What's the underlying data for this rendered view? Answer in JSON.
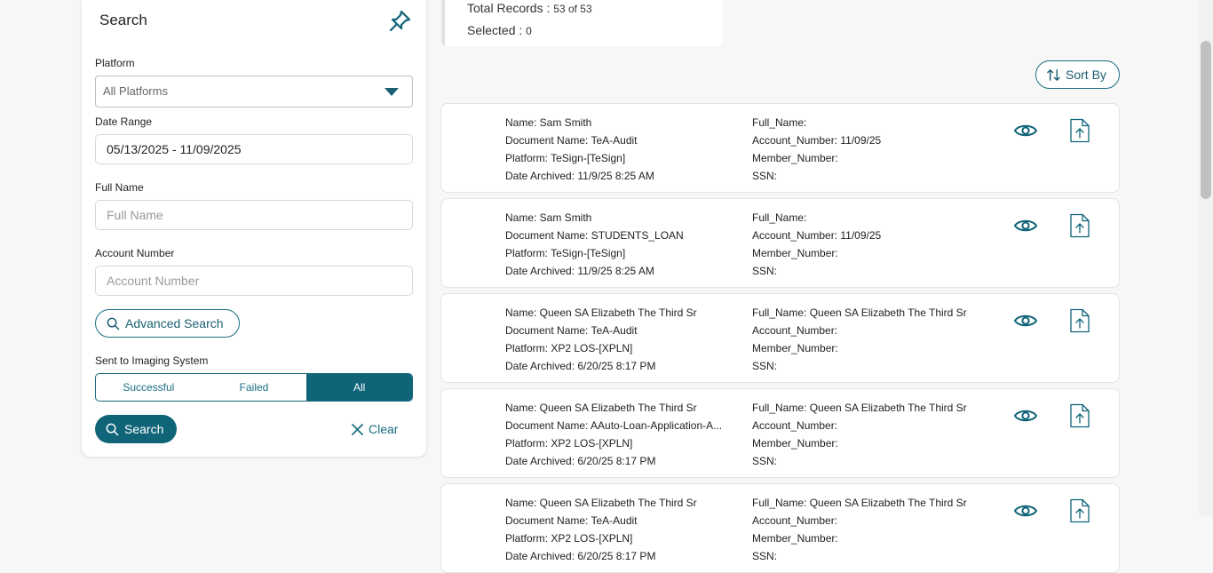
{
  "search_panel": {
    "title": "Search",
    "platform_label": "Platform",
    "platform_value": "All Platforms",
    "date_range_label": "Date Range",
    "date_range_value": "05/13/2025 - 11/09/2025",
    "full_name_label": "Full Name",
    "full_name_placeholder": "Full Name",
    "account_number_label": "Account Number",
    "account_number_placeholder": "Account Number",
    "advanced_search_label": "Advanced Search",
    "sent_label": "Sent to Imaging System",
    "segments": [
      "Successful",
      "Failed",
      "All"
    ],
    "active_segment": "All",
    "search_label": "Search",
    "clear_label": "Clear"
  },
  "totals": {
    "total_label": "Total Records :",
    "total_value": "53 of 53",
    "selected_label": "Selected :",
    "selected_value": "0"
  },
  "sort_label": "Sort By",
  "records": [
    {
      "left": [
        "Name: Sam Smith",
        "Document Name: TeA-Audit",
        "Platform: TeSign-[TeSign]",
        "Date Archived: 11/9/25 8:25 AM"
      ],
      "right": [
        "Full_Name:",
        "Account_Number: 11/09/25",
        "Member_Number:",
        "SSN:"
      ]
    },
    {
      "left": [
        "Name: Sam Smith",
        "Document Name: STUDENTS_LOAN",
        "Platform: TeSign-[TeSign]",
        "Date Archived: 11/9/25 8:25 AM"
      ],
      "right": [
        "Full_Name:",
        "Account_Number: 11/09/25",
        "Member_Number:",
        "SSN:"
      ]
    },
    {
      "left": [
        "Name: Queen SA Elizabeth The Third Sr",
        "Document Name: TeA-Audit",
        "Platform: XP2 LOS-[XPLN]",
        "Date Archived: 6/20/25 8:17 PM"
      ],
      "right": [
        "Full_Name: Queen SA Elizabeth The Third Sr",
        "Account_Number:",
        "Member_Number:",
        "SSN:"
      ]
    },
    {
      "left": [
        "Name: Queen SA Elizabeth The Third Sr",
        "Document Name: AAuto-Loan-Application-A...",
        "Platform: XP2 LOS-[XPLN]",
        "Date Archived: 6/20/25 8:17 PM"
      ],
      "right": [
        "Full_Name: Queen SA Elizabeth The Third Sr",
        "Account_Number:",
        "Member_Number:",
        "SSN:"
      ]
    },
    {
      "left": [
        "Name: Queen SA Elizabeth The Third Sr",
        "Document Name: TeA-Audit",
        "Platform: XP2 LOS-[XPLN]",
        "Date Archived: 6/20/25 8:17 PM"
      ],
      "right": [
        "Full_Name: Queen SA Elizabeth The Third Sr",
        "Account_Number:",
        "Member_Number:",
        "SSN:"
      ]
    }
  ],
  "colors": {
    "accent": "#0f6478",
    "accent_text": "#1a5f72"
  },
  "icons": [
    "pin-icon",
    "chevron-down-icon",
    "search-icon",
    "close-icon",
    "sort-icon",
    "eye-icon",
    "document-upload-icon"
  ]
}
